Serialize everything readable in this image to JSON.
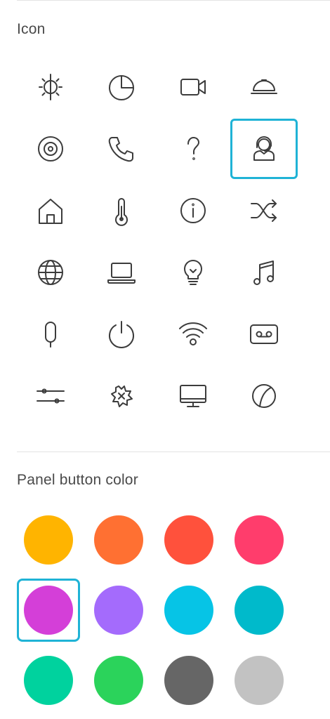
{
  "icon_section": {
    "title": "Icon",
    "icons": [
      {
        "name": "brightness",
        "selected": false
      },
      {
        "name": "pie-chart",
        "selected": false
      },
      {
        "name": "video-camera",
        "selected": false
      },
      {
        "name": "room-service-bell",
        "selected": false
      },
      {
        "name": "target-disc",
        "selected": false
      },
      {
        "name": "phone",
        "selected": false
      },
      {
        "name": "help-question",
        "selected": false
      },
      {
        "name": "concierge-headset",
        "selected": true
      },
      {
        "name": "home",
        "selected": false
      },
      {
        "name": "thermometer",
        "selected": false
      },
      {
        "name": "info",
        "selected": false
      },
      {
        "name": "shuffle",
        "selected": false
      },
      {
        "name": "globe",
        "selected": false
      },
      {
        "name": "laptop",
        "selected": false
      },
      {
        "name": "lightbulb",
        "selected": false
      },
      {
        "name": "music-note",
        "selected": false
      },
      {
        "name": "microphone",
        "selected": false
      },
      {
        "name": "power",
        "selected": false
      },
      {
        "name": "wifi-signal",
        "selected": false
      },
      {
        "name": "voicemail-tape",
        "selected": false
      },
      {
        "name": "sliders",
        "selected": false
      },
      {
        "name": "snowflake-badge",
        "selected": false
      },
      {
        "name": "monitor",
        "selected": false
      },
      {
        "name": "ball",
        "selected": false
      }
    ]
  },
  "color_section": {
    "title": "Panel button color",
    "colors": [
      {
        "hex": "#FFB400",
        "selected": false
      },
      {
        "hex": "#FF7032",
        "selected": false
      },
      {
        "hex": "#FF513C",
        "selected": false
      },
      {
        "hex": "#FF3D6C",
        "selected": false
      },
      {
        "hex": "#D43FD8",
        "selected": true
      },
      {
        "hex": "#A46BFC",
        "selected": false
      },
      {
        "hex": "#06C4E6",
        "selected": false
      },
      {
        "hex": "#00BACB",
        "selected": false
      },
      {
        "hex": "#00D29E",
        "selected": false
      },
      {
        "hex": "#2BD35B",
        "selected": false
      },
      {
        "hex": "#666666",
        "selected": false
      },
      {
        "hex": "#C2C2C2",
        "selected": false
      }
    ]
  }
}
